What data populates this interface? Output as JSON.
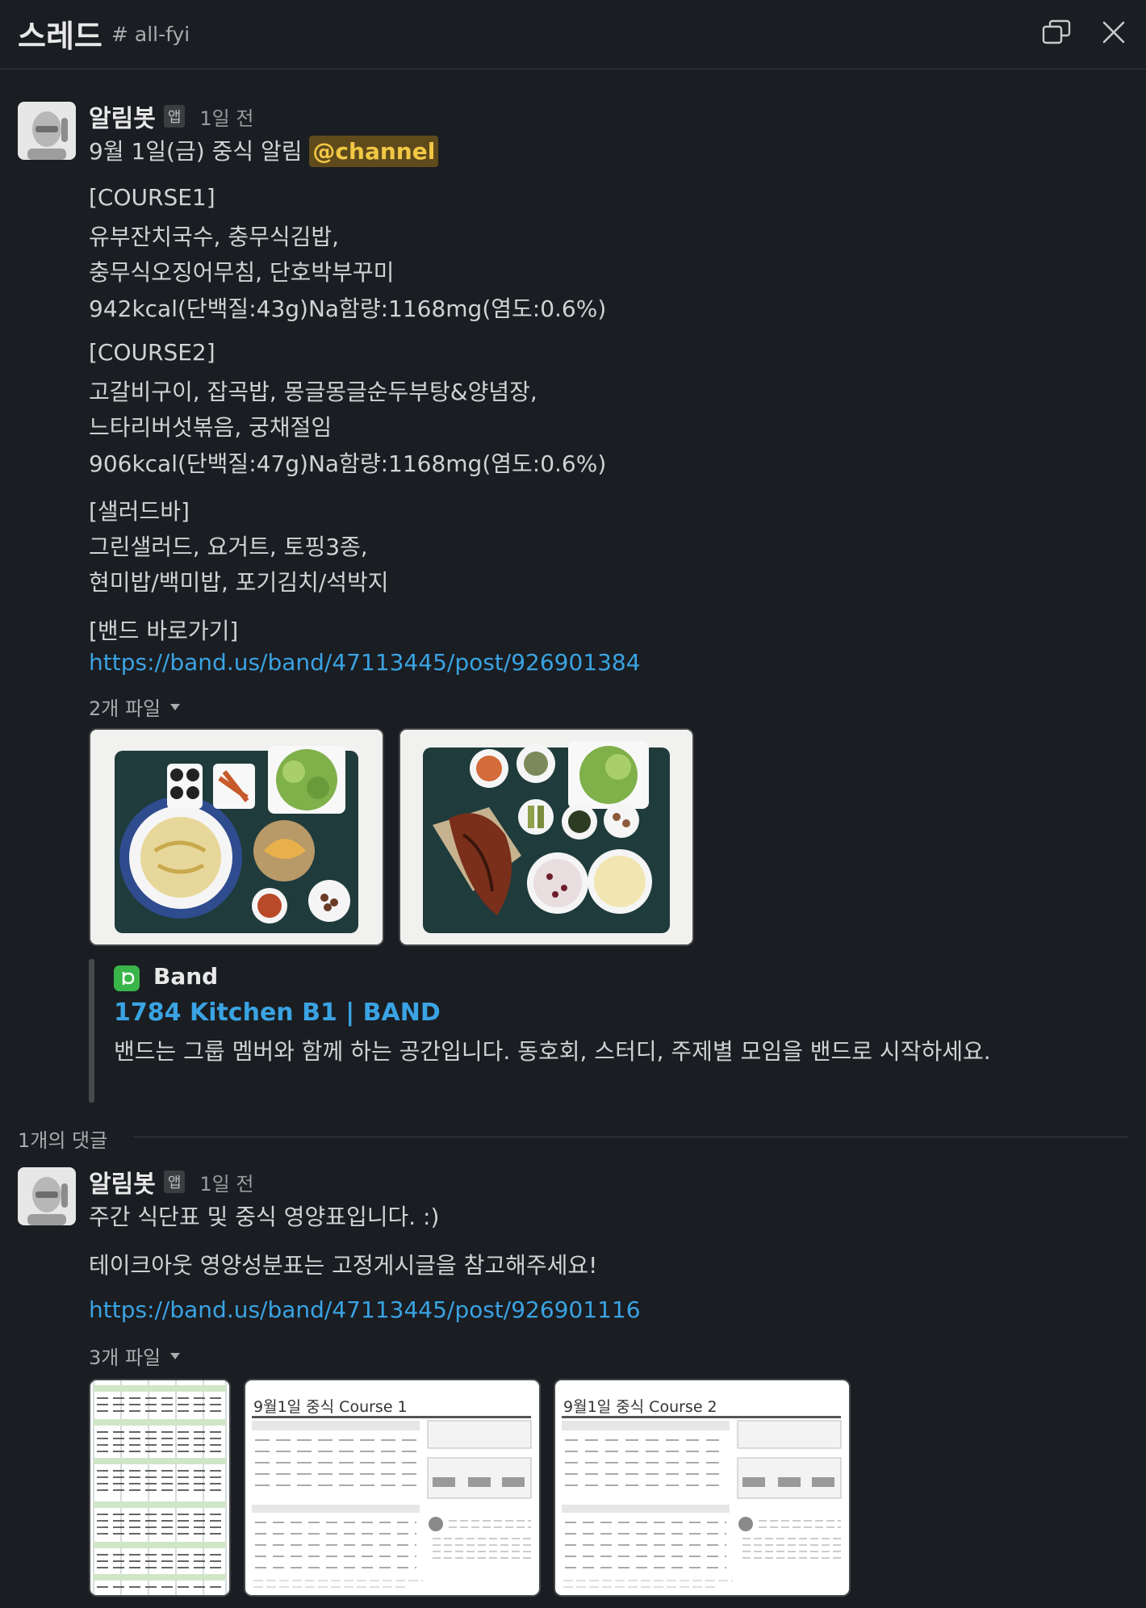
{
  "header": {
    "title": "스레드",
    "channel": "# all-fyi"
  },
  "parent_message": {
    "author": "알림봇",
    "badge": "앱",
    "time": "1일 전",
    "title_text": "9월 1일(금) 중식 알림",
    "mention": "@channel",
    "course1": {
      "heading": "[COURSE1]",
      "line1": "유부잔치국수, 충무식김밥,",
      "line2": "충무식오징어무침, 단호박부꾸미",
      "line3": "942kcal(단백질:43g)Na함량:1168mg(염도:0.6%)"
    },
    "course2": {
      "heading": "[COURSE2]",
      "line1": "고갈비구이, 잡곡밥, 몽글몽글순두부탕&양념장,",
      "line2": "느타리버섯볶음, 궁채절임",
      "line3": "906kcal(단백질:47g)Na함량:1168mg(염도:0.6%)"
    },
    "salad": {
      "heading": "[샐러드바]",
      "line1": "그린샐러드, 요거트, 토핑3종,",
      "line2": "현미밥/백미밥, 포기김치/석박지"
    },
    "band_heading": "[밴드 바로가기]",
    "link": "https://band.us/band/47113445/post/926901384",
    "files_label": "2개 파일",
    "unfurl": {
      "source": "Band",
      "title": "1784 Kitchen B1 | BAND",
      "description": "밴드는 그룹 멤버와 함께 하는 공간입니다. 동호회, 스터디, 주제별 모임을 밴드로 시작하세요."
    }
  },
  "replies_label": "1개의 댓글",
  "reply": {
    "author": "알림봇",
    "badge": "앱",
    "time": "1일 전",
    "line1": "주간 식단표 및 중식 영양표입니다. :)",
    "line2": "테이크아웃 영양성분표는 고정게시글을 참고해주세요!",
    "link": "https://band.us/band/47113445/post/926901116",
    "files_label": "3개 파일",
    "file_titles": [
      "9월1일 중식 Course 1",
      "9월1일 중식 Course 2"
    ]
  },
  "icons": {
    "open_window": "open-in-window-icon",
    "close": "close-icon",
    "band": "band-logo-icon",
    "caret": "caret-down-icon"
  },
  "colors": {
    "background": "#1a1d21",
    "link": "#3aa3e3",
    "mention_bg": "#5f4a1c",
    "mention_text": "#f2c744",
    "band_green": "#39b54a"
  }
}
